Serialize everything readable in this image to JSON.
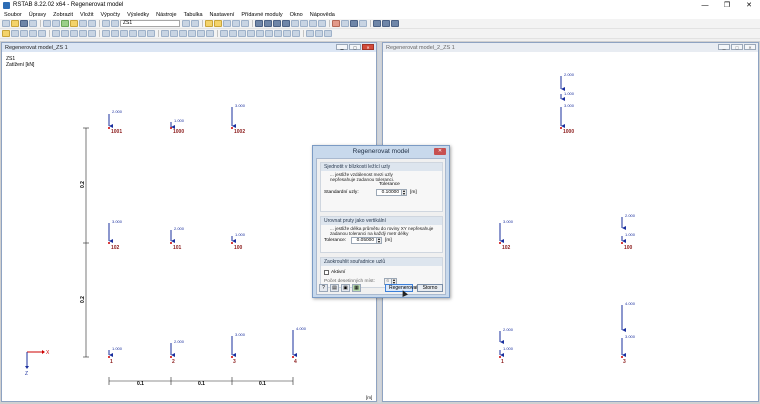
{
  "window": {
    "title": "RSTAB 8.22.02 x64 - Regenerovat model",
    "minimize": "—",
    "maximize": "❐",
    "close": "✕"
  },
  "menu": [
    "Soubor",
    "Úpravy",
    "Zobrazit",
    "Vložit",
    "Výpočty",
    "Výsledky",
    "Nástroje",
    "Tabulka",
    "Nastavení",
    "Přídavné moduly",
    "Okno",
    "Nápověda"
  ],
  "toolbar": {
    "loadcase": "ZS1"
  },
  "left_panel": {
    "title": "Regenerovat model_ZS 1",
    "info_line1": "ZS1",
    "info_line2": "Zatížení [kN]",
    "units": "[m]"
  },
  "right_panel": {
    "title": "Regenerovat model_2_ZS 1"
  },
  "left_model": {
    "top_loads": [
      {
        "value": "2.000",
        "node": "1001"
      },
      {
        "value": "1.000",
        "node": "1000"
      },
      {
        "value": "3.000",
        "node": "1002"
      }
    ],
    "mid_loads": [
      {
        "value": "3.000",
        "node": "102"
      },
      {
        "value": "2.000",
        "node": "101"
      },
      {
        "value": "1.000",
        "node": "100"
      }
    ],
    "bot_loads": [
      {
        "value": "1.000",
        "node": "1"
      },
      {
        "value": "2.000",
        "node": "2"
      },
      {
        "value": "3.000",
        "node": "3"
      },
      {
        "value": "4.000",
        "node": "4"
      }
    ],
    "dim_vertical": [
      "0.2",
      "0.2"
    ],
    "dim_horizontal": [
      "0.1",
      "0.1",
      "0.1"
    ],
    "axis_x": "X",
    "axis_z": "Z"
  },
  "right_model": {
    "top_stack": [
      "2.000",
      "1.000",
      "3.000"
    ],
    "top_node": "1000",
    "mid_left": {
      "value": "3.000",
      "node": "102"
    },
    "mid_right": [
      "2.000",
      "1.000"
    ],
    "mid_right_node": "100",
    "bot_left": [
      "2.000",
      "1.000"
    ],
    "bot_left_node": "1",
    "bot_right": [
      "4.000",
      "3.000"
    ],
    "bot_right_node": "3"
  },
  "dialog": {
    "title": "Regenerovat model",
    "close": "✕",
    "group1": {
      "heading": "Sjednotit v blízkosti ležící uzly",
      "desc1": "... jestliže vzdálenost mezi uzly",
      "desc2": "nepřesahuje zadanou toleranci.",
      "tolerance_header": "Tolerance",
      "label": "Standardní uzly:",
      "value": "0.10000",
      "unit": "[m]"
    },
    "group2": {
      "heading": "Urovnat pruty jako vertikální",
      "desc1": "... jestliže délka průmětu do roviny XY nepřesahuje",
      "desc2": "zadanou toleranci na každý metr délky",
      "label": "Tolerance:",
      "value": "0.05000",
      "unit": "[m]"
    },
    "group3": {
      "heading": "Zaokrouhlit souřadnice uzlů",
      "checkbox": "Aktivní",
      "label": "Počet desetinných míst:",
      "value": "6"
    },
    "buttons": {
      "regenerate": "Regenerovat",
      "cancel": "Storno"
    }
  }
}
